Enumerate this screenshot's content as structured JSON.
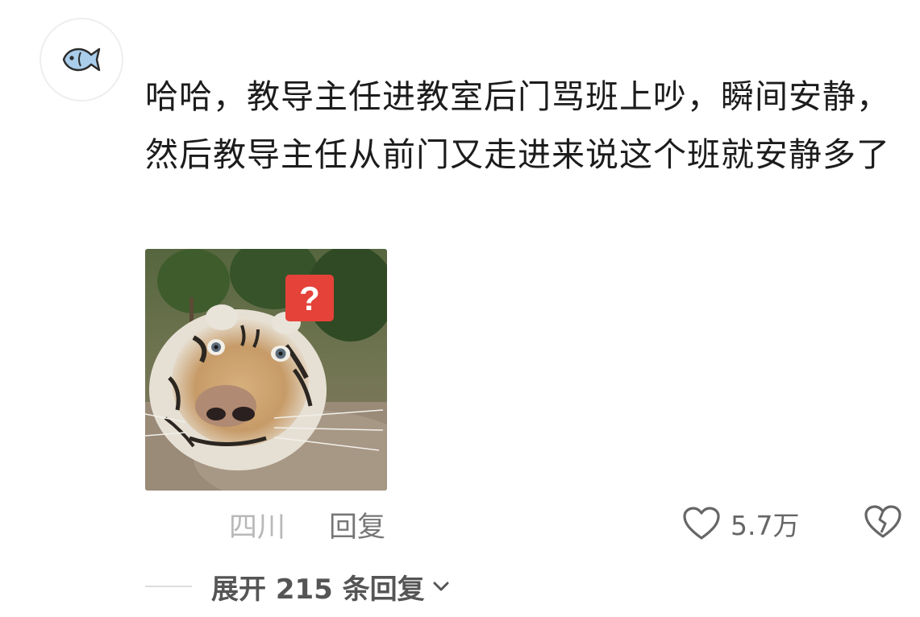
{
  "comment": {
    "text": "哈哈，教导主任进教室后门骂班上吵，瞬间安静，然后教导主任从前门又走进来说这个班就安静多了",
    "image_badge": "?",
    "location": "四川",
    "reply_label": "回复",
    "like_count": "5.7万",
    "expand_label": "展开 215 条回复",
    "icons": {
      "avatar": "fish-avatar-icon",
      "like": "heart-outline-icon",
      "dislike": "broken-heart-icon",
      "expand": "chevron-down-icon",
      "badge": "question-mark-icon"
    }
  },
  "colors": {
    "text": "#1c1c1c",
    "muted": "#b8b8b8",
    "secondary": "#777777",
    "badge": "#e5423a",
    "avatar_fish": "#a9cdea"
  }
}
